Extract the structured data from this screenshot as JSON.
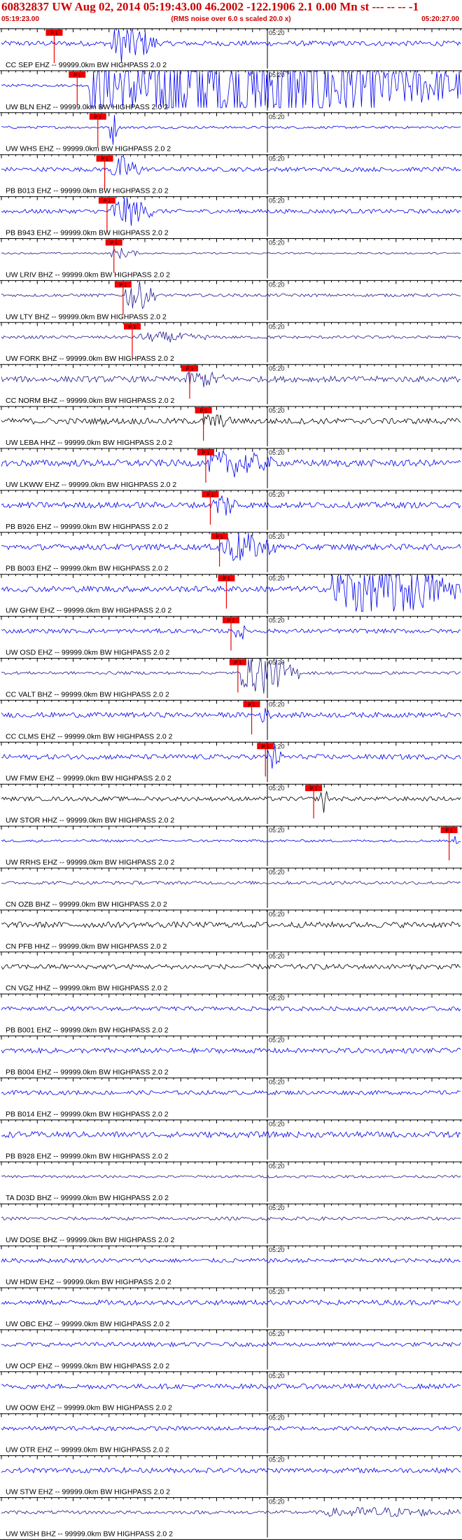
{
  "header": {
    "title": "60832837 UW Aug 02, 2014 05:19:43.00   46.2002 -122.1906  2.1 0.00 Mn st --- -- --   -1",
    "start_time": "05:19:23.00",
    "rms_note": "(RMS noise over 6.0 s scaled 20.0 x)",
    "end_time": "05:20:27.00"
  },
  "chart_data": {
    "type": "line",
    "description_of_axis": "time",
    "x_range": [
      "05:19:23.00",
      "05:20:27.00"
    ],
    "tick_label": "05:20",
    "pick_label": "P 1",
    "colors": {
      "blue": "#0000ee",
      "navy": "#1e1a8c",
      "black": "#000000",
      "pick": "#ee0000"
    },
    "series": [
      {
        "name": "CC SEP EHZ -- 99999.0km BW  HIGHPASS  2.0  2",
        "color": "blue",
        "amp": 0.12,
        "burst": [
          0.24,
          0.34,
          1.0
        ],
        "pick": 0.115
      },
      {
        "name": "UW BLN EHZ -- 99999.0km BW  HIGHPASS  2.0  2",
        "color": "blue",
        "amp": 0.06,
        "burst": [
          0.19,
          1.0,
          3.0
        ],
        "pick": 0.165
      },
      {
        "name": "UW WHS EHZ -- 99999.0km BW  HIGHPASS  2.0  2",
        "color": "blue",
        "amp": 0.06,
        "burst": [
          0.235,
          0.255,
          0.9
        ],
        "pick": 0.21
      },
      {
        "name": "PB B013 EHZ -- 99999.0km BW  HIGHPASS  2.0  2",
        "color": "blue",
        "amp": 0.1,
        "burst": [
          0.24,
          0.31,
          0.6
        ],
        "pick": 0.225
      },
      {
        "name": "PB B943 EHZ -- 99999.0km BW  HIGHPASS  2.0  2",
        "color": "blue",
        "amp": 0.1,
        "burst": [
          0.24,
          0.33,
          0.75
        ],
        "pick": 0.23
      },
      {
        "name": "UW LRIV BHZ -- 99999.0km BW  HIGHPASS  2.0  2",
        "color": "navy",
        "amp": 0.04,
        "burst": [
          0.24,
          0.3,
          0.25
        ],
        "pick": 0.245
      },
      {
        "name": "UW LTY BHZ -- 99999.0km BW  HIGHPASS  2.0  2",
        "color": "navy",
        "amp": 0.07,
        "burst": [
          0.27,
          0.34,
          0.75
        ],
        "pick": 0.265
      },
      {
        "name": "UW FORK BHZ -- 99999.0km BW  HIGHPASS  2.0  2",
        "color": "navy",
        "amp": 0.07,
        "burst": [
          0.3,
          0.45,
          0.2
        ],
        "pick": 0.285
      },
      {
        "name": "CC NORM BHZ -- 99999.0km BW  HIGHPASS  2.0  2",
        "color": "navy",
        "amp": 0.14,
        "burst": [
          0.4,
          0.5,
          0.3
        ],
        "pick": 0.41
      },
      {
        "name": "UW LEBA HHZ -- 99999.0km BW  HIGHPASS  2.0  2",
        "color": "black",
        "amp": 0.14,
        "burst": [
          0.44,
          0.5,
          0.3
        ],
        "pick": 0.44
      },
      {
        "name": "UW LKWW EHZ -- 99999.0km BW  HIGHPASS  2.0  2",
        "color": "blue",
        "amp": 0.16,
        "burst": [
          0.45,
          0.6,
          0.55
        ],
        "pick": 0.445
      },
      {
        "name": "PB B926 EHZ -- 99999.0km BW  HIGHPASS  2.0  2",
        "color": "blue",
        "amp": 0.14,
        "burst": [
          0.46,
          0.52,
          0.6
        ],
        "pick": 0.455
      },
      {
        "name": "PB B003 EHZ -- 99999.0km BW  HIGHPASS  2.0  2",
        "color": "blue",
        "amp": 0.14,
        "burst": [
          0.47,
          0.6,
          0.7
        ],
        "pick": 0.475
      },
      {
        "name": "UW GHW EHZ -- 99999.0km BW  HIGHPASS  2.0  2",
        "color": "blue",
        "amp": 0.14,
        "burst": [
          0.72,
          1.0,
          1.6
        ],
        "pick": 0.49
      },
      {
        "name": "UW OSD EHZ -- 99999.0km BW  HIGHPASS  2.0  2",
        "color": "blue",
        "amp": 0.1,
        "burst": [
          0.51,
          0.53,
          0.7
        ],
        "pick": 0.5
      },
      {
        "name": "CC VALT BHZ -- 99999.0km BW  HIGHPASS  2.0  2",
        "color": "navy",
        "amp": 0.07,
        "burst": [
          0.52,
          0.65,
          1.0
        ],
        "pick": 0.515
      },
      {
        "name": "CC CLMS EHZ -- 99999.0km BW  HIGHPASS  2.0  2",
        "color": "blue",
        "amp": 0.12,
        "burst": [
          0.56,
          0.59,
          0.3
        ],
        "pick": 0.545
      },
      {
        "name": "UW FMW EHZ -- 99999.0km BW  HIGHPASS  2.0  2",
        "color": "blue",
        "amp": 0.12,
        "burst": [
          0.58,
          0.61,
          0.7
        ],
        "pick": 0.575
      },
      {
        "name": "UW STOR HHZ -- 99999.0km BW  HIGHPASS  2.0  2",
        "color": "black",
        "amp": 0.1,
        "burst": [
          0.695,
          0.71,
          1.0
        ],
        "pick": 0.68
      },
      {
        "name": "UW RRHS EHZ -- 99999.0km BW  HIGHPASS  2.0  2",
        "color": "blue",
        "amp": 0.06,
        "burst": [
          0.985,
          0.995,
          0.45
        ],
        "pick": 0.975
      },
      {
        "name": "CN OZB BHZ -- 99999.0km BW  HIGHPASS  2.0  2",
        "color": "navy",
        "amp": 0.08
      },
      {
        "name": "CN PFB HHZ -- 99999.0km BW  HIGHPASS  2.0  2",
        "color": "black",
        "amp": 0.14
      },
      {
        "name": "CN VGZ HHZ -- 99999.0km BW  HIGHPASS  2.0  2",
        "color": "black",
        "amp": 0.12
      },
      {
        "name": "PB B001 EHZ -- 99999.0km BW  HIGHPASS  2.0  2",
        "color": "blue",
        "amp": 0.1
      },
      {
        "name": "PB B004 EHZ -- 99999.0km BW  HIGHPASS  2.0  2",
        "color": "blue",
        "amp": 0.12
      },
      {
        "name": "PB B014 EHZ -- 99999.0km BW  HIGHPASS  2.0  2",
        "color": "blue",
        "amp": 0.1
      },
      {
        "name": "PB B928 EHZ -- 99999.0km BW  HIGHPASS  2.0  2",
        "color": "blue",
        "amp": 0.14
      },
      {
        "name": "TA D03D BHZ -- 99999.0km BW  HIGHPASS  2.0  2",
        "color": "navy",
        "amp": 0.06
      },
      {
        "name": "UW DOSE BHZ -- 99999.0km BW  HIGHPASS  2.0  2",
        "color": "navy",
        "amp": 0.08
      },
      {
        "name": "UW HDW EHZ -- 99999.0km BW  HIGHPASS  2.0  2",
        "color": "blue",
        "amp": 0.1
      },
      {
        "name": "UW OBC EHZ -- 99999.0km BW  HIGHPASS  2.0  2",
        "color": "blue",
        "amp": 0.12
      },
      {
        "name": "UW OCP EHZ -- 99999.0km BW  HIGHPASS  2.0  2",
        "color": "blue",
        "amp": 0.1
      },
      {
        "name": "UW OOW EHZ -- 99999.0km BW  HIGHPASS  2.0  2",
        "color": "blue",
        "amp": 0.12
      },
      {
        "name": "UW OTR EHZ -- 99999.0km BW  HIGHPASS  2.0  2",
        "color": "blue",
        "amp": 0.1
      },
      {
        "name": "UW STW EHZ -- 99999.0km BW  HIGHPASS  2.0  2",
        "color": "blue",
        "amp": 0.12
      },
      {
        "name": "UW WISH BHZ -- 99999.0km BW  HIGHPASS  2.0  2",
        "color": "navy",
        "amp": 0.08,
        "burst": [
          0.7,
          1.0,
          0.2
        ]
      }
    ]
  }
}
